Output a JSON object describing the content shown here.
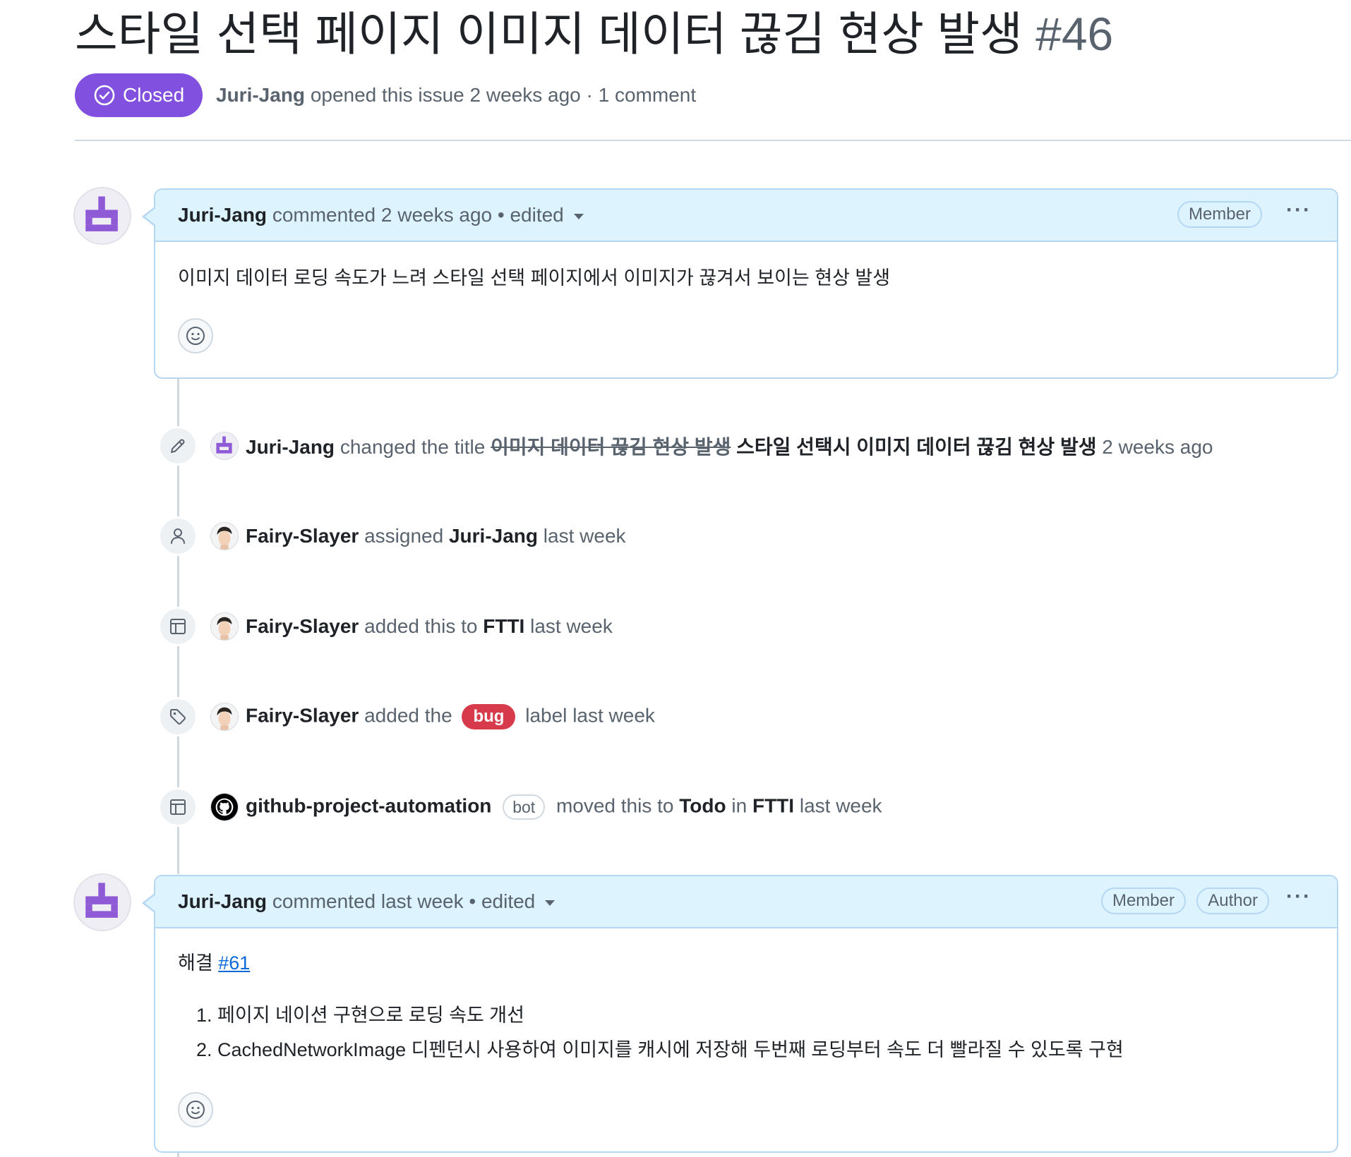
{
  "issue": {
    "title": "스타일 선택 페이지 이미지 데이터 끊김 현상 발생",
    "number": "#46",
    "state": "Closed",
    "author": "Juri-Jang",
    "meta_text": "opened this issue 2 weeks ago · 1 comment"
  },
  "comments": [
    {
      "author": "Juri-Jang",
      "meta": "commented 2 weeks ago • edited",
      "badges": [
        "Member"
      ],
      "body": "이미지 데이터 로딩 속도가 느려 스타일 선택 페이지에서 이미지가 끊겨서 보이는 현상 발생"
    },
    {
      "author": "Juri-Jang",
      "meta": "commented last week • edited",
      "badges": [
        "Member",
        "Author"
      ],
      "body_prefix": "해결",
      "body_ref": "#61",
      "list": [
        "1. 페이지 네이션 구현으로 로딩 속도 개선",
        "2. CachedNetworkImage 디펜던시 사용하여 이미지를 캐시에 저장해 두번째 로딩부터 속도 더 빨라질 수 있도록 구현"
      ]
    }
  ],
  "events": [
    {
      "icon": "pencil-icon",
      "actor": "Juri-Jang",
      "action": "changed the title",
      "old_title": "이미지 데이터 끊김 현상 발생",
      "new_title": "스타일 선택시 이미지 데이터 끊김 현상 발생",
      "time": "2 weeks ago"
    },
    {
      "icon": "person-icon",
      "actor": "Fairy-Slayer",
      "action": "assigned",
      "target": "Juri-Jang",
      "time": "last week"
    },
    {
      "icon": "project-table-icon",
      "actor": "Fairy-Slayer",
      "action": "added this to",
      "target": "FTTI",
      "time": "last week"
    },
    {
      "icon": "tag-icon",
      "actor": "Fairy-Slayer",
      "action": "added the",
      "label": "bug",
      "after": "label",
      "time": "last week"
    },
    {
      "icon": "project-table-icon",
      "actor": "github-project-automation",
      "bot": "bot",
      "action": "moved this to",
      "target": "Todo",
      "in": "in",
      "target2": "FTTI",
      "time": "last week"
    }
  ],
  "colors": {
    "closed": "#8250df",
    "comment_header": "#ddf4ff",
    "comment_border": "#b6d7f4",
    "bug_label": "#d73a4a",
    "link": "#0969da"
  }
}
